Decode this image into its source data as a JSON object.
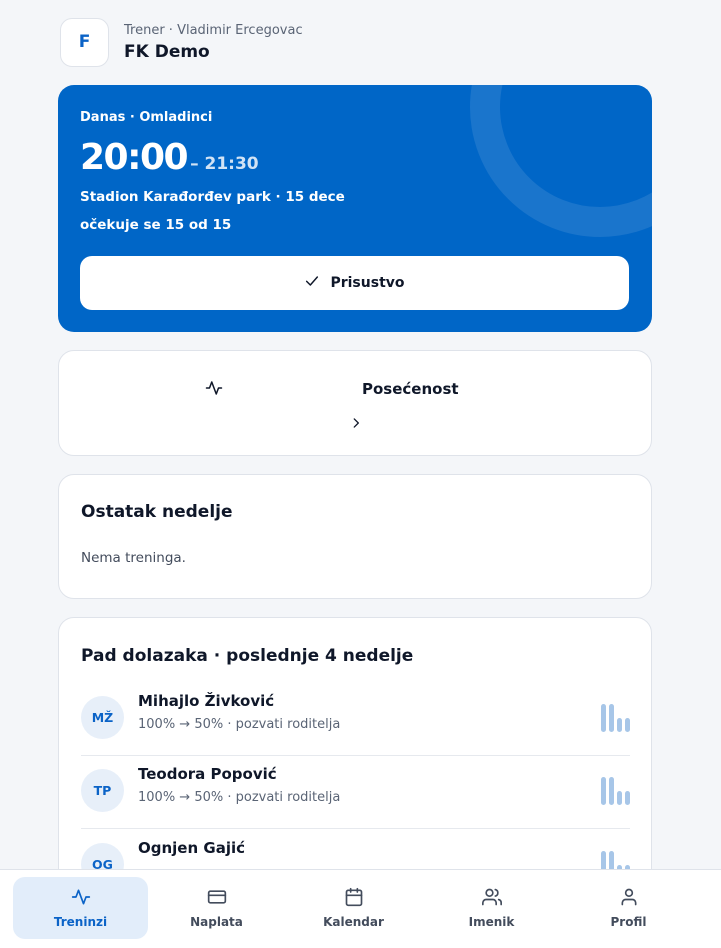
{
  "header": {
    "logo_letter": "F",
    "subtitle": "Trener · Vladimir Ercegovac",
    "title": "FK Demo"
  },
  "today": {
    "kicker": "Danas · Omladinci",
    "start_time": "20:00",
    "end_time": "– 21:30",
    "location": "Stadion Karađorđev park · 15 dece",
    "expected": "očekuje se 15 od 15",
    "button_label": "Prisustvo",
    "button_icon": "check-icon"
  },
  "attendance": {
    "title": "Posećenost",
    "icon": "activity-icon"
  },
  "week": {
    "title": "Ostatak nedelje",
    "empty_text": "Nema treninga."
  },
  "drop": {
    "title": "Pad dolazaka · poslednje 4 nedelje",
    "players": [
      {
        "initials": "MŽ",
        "name": "Mihajlo Živković",
        "meta": "100% → 50% · pozvati roditelja",
        "weeks": [
          1,
          1,
          0.5,
          0.5
        ]
      },
      {
        "initials": "TP",
        "name": "Teodora Popović",
        "meta": "100% → 50% · pozvati roditelja",
        "weeks": [
          1,
          1,
          0.5,
          0.5
        ]
      },
      {
        "initials": "OG",
        "name": "Ognjen Gajić",
        "meta": "",
        "weeks": [
          1,
          1,
          0.5,
          0.5
        ]
      }
    ]
  },
  "nav": {
    "items": [
      {
        "label": "Treninzi",
        "icon": "activity-icon",
        "active": true
      },
      {
        "label": "Naplata",
        "icon": "credit-card-icon",
        "active": false
      },
      {
        "label": "Kalendar",
        "icon": "calendar-icon",
        "active": false
      },
      {
        "label": "Imenik",
        "icon": "users-icon",
        "active": false
      },
      {
        "label": "Profil",
        "icon": "user-icon",
        "active": false
      }
    ]
  },
  "colors": {
    "accent": "#0066c7",
    "accent_light": "#e2edfa",
    "bar": "#a7c6e8",
    "background": "#f4f6f9"
  }
}
